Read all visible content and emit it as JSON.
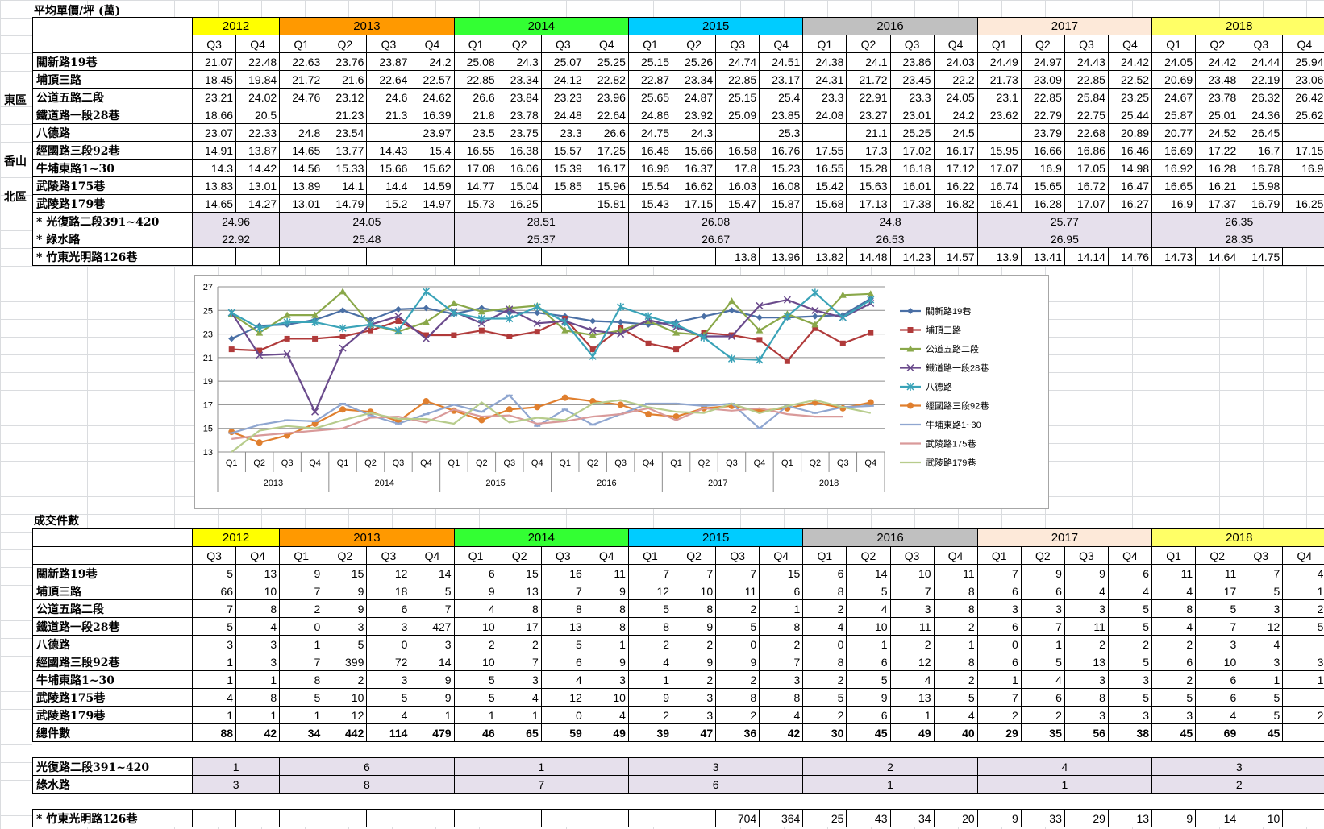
{
  "sheet": {
    "price_title": "平均單價/坪 (萬)",
    "count_title": "成交件數",
    "regions": {
      "east": "東區",
      "xiangshan": "香山",
      "north": "北區"
    }
  },
  "colors": {
    "2012": "#ffff00",
    "2013": "#ff9900",
    "2014": "#33ff33",
    "2015": "#00ccff",
    "2016": "#c0c0c0",
    "2017": "#fde9d9",
    "2018": "#ffff66",
    "highlight": "#e6e0ec"
  },
  "years": [
    {
      "label": "2012",
      "quarters": [
        "Q3",
        "Q4"
      ]
    },
    {
      "label": "2013",
      "quarters": [
        "Q1",
        "Q2",
        "Q3",
        "Q4"
      ]
    },
    {
      "label": "2014",
      "quarters": [
        "Q1",
        "Q2",
        "Q3",
        "Q4"
      ]
    },
    {
      "label": "2015",
      "quarters": [
        "Q1",
        "Q2",
        "Q3",
        "Q4"
      ]
    },
    {
      "label": "2016",
      "quarters": [
        "Q1",
        "Q2",
        "Q3",
        "Q4"
      ]
    },
    {
      "label": "2017",
      "quarters": [
        "Q1",
        "Q2",
        "Q3",
        "Q4"
      ]
    },
    {
      "label": "2018",
      "quarters": [
        "Q1",
        "Q2",
        "Q3",
        "Q4"
      ]
    }
  ],
  "price_rows": [
    {
      "name": "關新路19巷",
      "values": [
        "21.07",
        "22.48",
        "22.63",
        "23.76",
        "23.87",
        "24.2",
        "25.08",
        "24.3",
        "25.07",
        "25.25",
        "25.15",
        "25.26",
        "24.74",
        "24.51",
        "24.38",
        "24.1",
        "23.86",
        "24.03",
        "24.49",
        "24.97",
        "24.43",
        "24.42",
        "24.05",
        "24.42",
        "24.44",
        "25.94"
      ]
    },
    {
      "name": "埔頂三路",
      "values": [
        "18.45",
        "19.84",
        "21.72",
        "21.6",
        "22.64",
        "22.57",
        "22.85",
        "23.34",
        "24.12",
        "22.82",
        "22.87",
        "23.34",
        "22.85",
        "23.17",
        "24.31",
        "21.72",
        "23.45",
        "22.2",
        "21.73",
        "23.09",
        "22.85",
        "22.52",
        "20.69",
        "23.48",
        "22.19",
        "23.06"
      ]
    },
    {
      "name": "公道五路二段",
      "values": [
        "23.21",
        "24.02",
        "24.76",
        "23.12",
        "24.6",
        "24.62",
        "26.6",
        "23.84",
        "23.23",
        "23.96",
        "25.65",
        "24.87",
        "25.15",
        "25.4",
        "23.3",
        "22.91",
        "23.3",
        "24.05",
        "23.1",
        "22.85",
        "25.84",
        "23.25",
        "24.67",
        "23.78",
        "26.32",
        "26.42"
      ]
    },
    {
      "name": "鐵道路一段28巷",
      "values": [
        "18.66",
        "20.5",
        "",
        "21.23",
        "21.3",
        "16.39",
        "21.8",
        "23.78",
        "24.48",
        "22.64",
        "24.86",
        "23.92",
        "25.09",
        "23.85",
        "24.08",
        "23.27",
        "23.01",
        "24.2",
        "23.62",
        "22.79",
        "22.75",
        "25.44",
        "25.87",
        "25.01",
        "24.36",
        "25.62"
      ]
    },
    {
      "name": "八德路",
      "values": [
        "23.07",
        "22.33",
        "24.8",
        "23.54",
        "",
        "23.97",
        "23.5",
        "23.75",
        "23.3",
        "26.6",
        "24.75",
        "24.3",
        "",
        "25.3",
        "",
        "21.1",
        "25.25",
        "24.5",
        "",
        "23.79",
        "22.68",
        "20.89",
        "20.77",
        "24.52",
        "26.45",
        ""
      ]
    },
    {
      "name": "經國路三段92巷",
      "values": [
        "14.91",
        "13.87",
        "14.65",
        "13.77",
        "14.43",
        "15.4",
        "16.55",
        "16.38",
        "15.57",
        "17.25",
        "16.46",
        "15.66",
        "16.58",
        "16.76",
        "17.55",
        "17.3",
        "17.02",
        "16.17",
        "15.95",
        "16.66",
        "16.86",
        "16.46",
        "16.69",
        "17.22",
        "16.7",
        "17.15"
      ]
    },
    {
      "name": "牛埔東路1~30",
      "values": [
        "14.3",
        "14.42",
        "14.56",
        "15.33",
        "15.66",
        "15.62",
        "17.08",
        "16.06",
        "15.39",
        "16.17",
        "16.96",
        "16.37",
        "17.8",
        "15.23",
        "16.55",
        "15.28",
        "16.18",
        "17.12",
        "17.07",
        "16.9",
        "17.05",
        "14.98",
        "16.92",
        "16.28",
        "16.78",
        "16.9"
      ]
    },
    {
      "name": "武陵路175巷",
      "values": [
        "13.83",
        "13.01",
        "13.89",
        "14.1",
        "14.4",
        "14.59",
        "14.77",
        "15.04",
        "15.85",
        "15.96",
        "15.54",
        "16.62",
        "16.03",
        "16.08",
        "15.42",
        "15.63",
        "16.01",
        "16.22",
        "16.74",
        "15.65",
        "16.72",
        "16.47",
        "16.65",
        "16.21",
        "15.98",
        ""
      ]
    },
    {
      "name": "武陵路179巷",
      "values": [
        "14.65",
        "14.27",
        "13.01",
        "14.79",
        "15.2",
        "14.97",
        "15.73",
        "16.25",
        "",
        "15.81",
        "15.43",
        "17.15",
        "15.47",
        "15.87",
        "15.68",
        "17.13",
        "17.38",
        "16.82",
        "16.41",
        "16.28",
        "17.07",
        "16.27",
        "16.9",
        "17.37",
        "16.79",
        "16.25"
      ]
    }
  ],
  "price_extra": [
    {
      "name": "* 光復路二段391~420",
      "years": [
        "24.96",
        "24.05",
        "28.51",
        "26.08",
        "24.8",
        "25.77",
        "26.35"
      ]
    },
    {
      "name": "* 綠水路",
      "years": [
        "22.92",
        "25.48",
        "25.37",
        "26.67",
        "26.53",
        "26.95",
        "28.35"
      ]
    }
  ],
  "price_zhudong": {
    "name": "* 竹東光明路126巷",
    "values": [
      "",
      "",
      "",
      "",
      "",
      "",
      "",
      "",
      "",
      "",
      "",
      "",
      "13.8",
      "13.96",
      "13.82",
      "14.48",
      "14.23",
      "14.57",
      "13.9",
      "13.41",
      "14.14",
      "14.76",
      "14.73",
      "14.64",
      "14.75",
      ""
    ]
  },
  "count_rows": [
    {
      "name": "關新路19巷",
      "values": [
        "5",
        "13",
        "9",
        "15",
        "12",
        "14",
        "6",
        "15",
        "16",
        "11",
        "7",
        "7",
        "7",
        "15",
        "6",
        "14",
        "10",
        "11",
        "7",
        "9",
        "9",
        "6",
        "11",
        "11",
        "7",
        "4"
      ]
    },
    {
      "name": "埔頂三路",
      "values": [
        "66",
        "10",
        "7",
        "9",
        "18",
        "5",
        "9",
        "13",
        "7",
        "9",
        "12",
        "10",
        "11",
        "6",
        "8",
        "5",
        "7",
        "8",
        "6",
        "6",
        "4",
        "4",
        "4",
        "17",
        "5",
        "1"
      ]
    },
    {
      "name": "公道五路二段",
      "values": [
        "7",
        "8",
        "2",
        "9",
        "6",
        "7",
        "4",
        "8",
        "8",
        "8",
        "5",
        "8",
        "2",
        "1",
        "2",
        "4",
        "3",
        "8",
        "3",
        "3",
        "3",
        "5",
        "8",
        "5",
        "3",
        "2"
      ]
    },
    {
      "name": "鐵道路一段28巷",
      "values": [
        "5",
        "4",
        "0",
        "3",
        "3",
        "427",
        "10",
        "17",
        "13",
        "8",
        "8",
        "9",
        "5",
        "8",
        "4",
        "10",
        "11",
        "2",
        "6",
        "7",
        "11",
        "5",
        "4",
        "7",
        "12",
        "5"
      ]
    },
    {
      "name": "八德路",
      "values": [
        "3",
        "3",
        "1",
        "5",
        "0",
        "3",
        "2",
        "2",
        "5",
        "1",
        "2",
        "2",
        "0",
        "2",
        "0",
        "1",
        "2",
        "1",
        "0",
        "1",
        "2",
        "2",
        "2",
        "3",
        "4",
        ""
      ]
    },
    {
      "name": "經國路三段92巷",
      "values": [
        "1",
        "3",
        "7",
        "399",
        "72",
        "14",
        "10",
        "7",
        "6",
        "9",
        "4",
        "9",
        "9",
        "7",
        "8",
        "6",
        "12",
        "8",
        "6",
        "5",
        "13",
        "5",
        "6",
        "10",
        "3",
        "3"
      ]
    },
    {
      "name": "牛埔東路1~30",
      "values": [
        "1",
        "1",
        "8",
        "2",
        "3",
        "9",
        "5",
        "3",
        "4",
        "3",
        "1",
        "2",
        "2",
        "3",
        "2",
        "5",
        "4",
        "2",
        "1",
        "4",
        "3",
        "3",
        "2",
        "6",
        "1",
        "1"
      ]
    },
    {
      "name": "武陵路175巷",
      "values": [
        "4",
        "8",
        "5",
        "10",
        "5",
        "9",
        "5",
        "4",
        "12",
        "10",
        "9",
        "3",
        "8",
        "8",
        "5",
        "9",
        "13",
        "5",
        "7",
        "6",
        "8",
        "5",
        "5",
        "6",
        "5",
        ""
      ]
    },
    {
      "name": "武陵路179巷",
      "values": [
        "1",
        "1",
        "1",
        "12",
        "4",
        "1",
        "1",
        "1",
        "0",
        "4",
        "2",
        "3",
        "2",
        "4",
        "2",
        "6",
        "1",
        "4",
        "2",
        "2",
        "3",
        "3",
        "3",
        "4",
        "5",
        "2"
      ]
    },
    {
      "name": "總件數",
      "values": [
        "88",
        "42",
        "34",
        "442",
        "114",
        "479",
        "46",
        "65",
        "59",
        "49",
        "39",
        "47",
        "36",
        "42",
        "30",
        "45",
        "49",
        "40",
        "29",
        "35",
        "56",
        "38",
        "45",
        "69",
        "45",
        ""
      ]
    }
  ],
  "count_extra": [
    {
      "name": "光復路二段391~420",
      "years": [
        "1",
        "6",
        "1",
        "3",
        "2",
        "4",
        "3"
      ]
    },
    {
      "name": "綠水路",
      "years": [
        "3",
        "8",
        "7",
        "6",
        "1",
        "1",
        "2"
      ]
    }
  ],
  "count_zhudong": {
    "name": "* 竹東光明路126巷",
    "values": [
      "",
      "",
      "",
      "",
      "",
      "",
      "",
      "",
      "",
      "",
      "",
      "",
      "704",
      "364",
      "25",
      "43",
      "34",
      "20",
      "9",
      "33",
      "29",
      "13",
      "9",
      "14",
      "10",
      ""
    ]
  },
  "chart_data": {
    "type": "line",
    "title": "",
    "xlabel": "",
    "ylabel": "",
    "ylim": [
      13,
      27
    ],
    "yticks": [
      13,
      15,
      17,
      19,
      21,
      23,
      25,
      27
    ],
    "grid": true,
    "legend": "right",
    "x_quarters": [
      "Q1",
      "Q2",
      "Q3",
      "Q4",
      "Q1",
      "Q2",
      "Q3",
      "Q4",
      "Q1",
      "Q2",
      "Q3",
      "Q4",
      "Q1",
      "Q2",
      "Q3",
      "Q4",
      "Q1",
      "Q2",
      "Q3",
      "Q4",
      "Q1",
      "Q2",
      "Q3",
      "Q4"
    ],
    "x_years": [
      "2013",
      "2014",
      "2015",
      "2016",
      "2017",
      "2018"
    ],
    "series": [
      {
        "name": "關新路19巷",
        "color": "#4a6fa5",
        "marker": "diamond",
        "values": [
          22.6,
          23.7,
          23.8,
          24.2,
          25.0,
          24.2,
          25.1,
          25.2,
          24.7,
          25.2,
          24.8,
          24.8,
          24.5,
          24.1,
          24.0,
          23.8,
          24.0,
          24.5,
          25.0,
          24.4,
          24.4,
          24.5,
          24.6,
          26.0
        ]
      },
      {
        "name": "埔頂三路",
        "color": "#b03a3a",
        "marker": "square",
        "values": [
          21.7,
          21.6,
          22.6,
          22.6,
          22.8,
          23.3,
          24.1,
          22.9,
          22.9,
          23.3,
          22.8,
          23.2,
          24.3,
          21.7,
          23.5,
          22.2,
          21.7,
          23.1,
          22.9,
          22.5,
          20.7,
          23.5,
          22.2,
          23.1
        ]
      },
      {
        "name": "公道五路二段",
        "color": "#8aa84a",
        "marker": "triangle",
        "values": [
          24.7,
          23.1,
          24.6,
          24.6,
          26.6,
          23.8,
          23.2,
          24.0,
          25.6,
          24.9,
          25.2,
          25.4,
          23.3,
          22.9,
          23.3,
          24.1,
          23.1,
          22.9,
          25.8,
          23.3,
          24.7,
          23.8,
          26.3,
          26.4
        ]
      },
      {
        "name": "鐵道路一段28巷",
        "color": "#6a4a8c",
        "marker": "x",
        "values": [
          24.8,
          21.2,
          21.3,
          16.4,
          21.8,
          23.8,
          24.5,
          22.6,
          24.9,
          23.9,
          25.1,
          23.9,
          24.1,
          23.3,
          23.0,
          24.2,
          23.6,
          22.8,
          22.8,
          25.4,
          25.9,
          25.0,
          24.4,
          25.6
        ]
      },
      {
        "name": "八德路",
        "color": "#3aa3b8",
        "marker": "star",
        "values": [
          24.8,
          23.5,
          24.0,
          24.0,
          23.5,
          23.8,
          23.3,
          26.6,
          24.8,
          24.3,
          24.3,
          25.3,
          24.0,
          21.1,
          25.3,
          24.5,
          23.8,
          22.7,
          20.9,
          20.8,
          24.5,
          26.5,
          24.4,
          25.9
        ]
      },
      {
        "name": "經國路三段92巷",
        "color": "#e07f2e",
        "marker": "circle",
        "values": [
          14.7,
          13.8,
          14.4,
          15.4,
          16.6,
          16.4,
          15.6,
          17.3,
          16.5,
          15.7,
          16.6,
          16.8,
          17.6,
          17.3,
          17.0,
          16.2,
          16.0,
          16.7,
          16.9,
          16.5,
          16.7,
          17.2,
          16.7,
          17.2
        ]
      },
      {
        "name": "牛埔東路1~30",
        "color": "#8fa6d0",
        "marker": "dash",
        "values": [
          14.6,
          15.3,
          15.7,
          15.6,
          17.1,
          16.1,
          15.4,
          16.2,
          17.0,
          16.4,
          17.8,
          15.2,
          16.6,
          15.3,
          16.2,
          17.1,
          17.1,
          16.9,
          17.1,
          15.0,
          16.9,
          16.3,
          16.8,
          16.9
        ]
      },
      {
        "name": "武陵路175巷",
        "color": "#d99a9a",
        "marker": "none",
        "values": [
          14.1,
          14.4,
          14.6,
          14.8,
          15.0,
          15.9,
          16.0,
          15.5,
          16.6,
          16.0,
          16.1,
          15.4,
          15.6,
          16.0,
          16.2,
          16.7,
          15.7,
          16.7,
          16.5,
          16.7,
          16.2,
          16.0,
          16.0,
          null
        ]
      },
      {
        "name": "武陵路179巷",
        "color": "#b7cc8c",
        "marker": "none",
        "values": [
          13.0,
          14.8,
          15.2,
          15.0,
          15.7,
          16.3,
          15.8,
          15.8,
          15.4,
          17.2,
          15.5,
          15.9,
          15.7,
          17.1,
          17.4,
          16.8,
          16.4,
          16.3,
          17.1,
          16.3,
          16.9,
          17.4,
          16.8,
          16.3
        ]
      }
    ]
  }
}
